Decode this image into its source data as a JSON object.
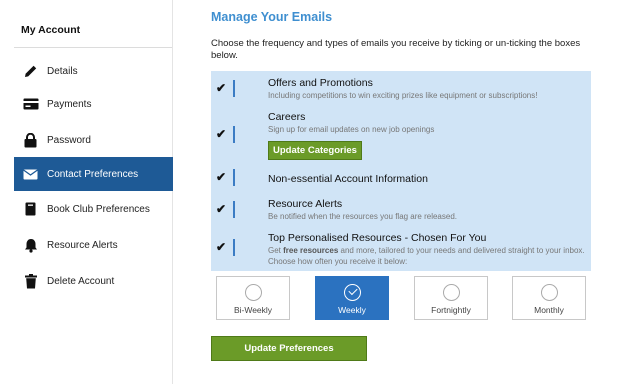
{
  "sidebar": {
    "title": "My Account",
    "items": [
      {
        "label": "Details",
        "icon": "pencil-icon"
      },
      {
        "label": "Payments",
        "icon": "credit-card-icon"
      },
      {
        "label": "Password",
        "icon": "lock-icon"
      },
      {
        "label": "Contact Preferences",
        "icon": "envelope-icon",
        "active": true
      },
      {
        "label": "Book Club Preferences",
        "icon": "book-icon"
      },
      {
        "label": "Resource Alerts",
        "icon": "bell-icon"
      },
      {
        "label": "Delete Account",
        "icon": "trash-icon"
      }
    ]
  },
  "main": {
    "title": "Manage Your Emails",
    "intro": "Choose the frequency and types of emails you receive by ticking or un-ticking the boxes below."
  },
  "preferences": [
    {
      "title": "Offers and Promotions",
      "desc": "Including competitions to win exciting prizes like equipment or subscriptions!",
      "checked": true
    },
    {
      "title": "Careers",
      "desc": "Sign up for email updates on new job openings",
      "checked": true,
      "button": "Update Categories"
    },
    {
      "title": "Non-essential Account Information",
      "desc": "",
      "checked": true
    },
    {
      "title": "Resource Alerts",
      "desc": "Be notified when the resources you flag are released.",
      "checked": true
    },
    {
      "title": "Top Personalised Resources - Chosen For You",
      "desc_prefix": "Get ",
      "desc_bold": "free resources",
      "desc_suffix": " and more, tailored to your needs and delivered straight to your inbox. Choose how often you receive it below:",
      "checked": true
    }
  ],
  "check_glyph": "✔",
  "frequency": {
    "options": [
      "Bi-Weekly",
      "Weekly",
      "Fortnightly",
      "Monthly"
    ],
    "selected": "Weekly"
  },
  "submit_label": "Update Preferences",
  "colors": {
    "accent": "#3f8fd0",
    "active_nav": "#1e5a96",
    "panel": "#d0e4f6",
    "green_button": "#6b9b28",
    "selected_option": "#2b72c0"
  }
}
